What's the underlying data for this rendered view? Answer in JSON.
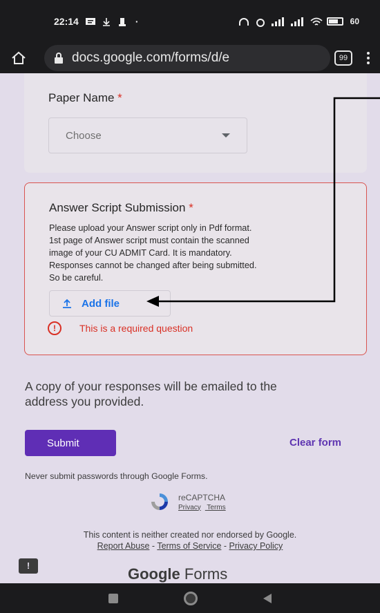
{
  "status_bar": {
    "time": "22:14",
    "battery": "60"
  },
  "browser": {
    "url": "docs.google.com/forms/d/e",
    "tab_count": "99"
  },
  "form": {
    "paper_question": {
      "title": "Paper Name",
      "required_mark": "*",
      "dropdown_value": "Choose"
    },
    "answer_question": {
      "title": "Answer Script Submission",
      "required_mark": "*",
      "description_lines": [
        "Please upload your Answer script only in Pdf format.",
        "1st page of Answer script must contain the scanned",
        "image of your CU ADMIT Card. It is mandatory.",
        "Responses cannot be changed after being submitted.",
        "So be careful."
      ],
      "add_file_label": "Add file",
      "error_text": "This is a required question"
    },
    "copy_note_line1": "A copy of your responses will be emailed to the",
    "copy_note_line2": "address you provided.",
    "submit_label": "Submit",
    "clear_label": "Clear form",
    "password_note": "Never submit passwords through Google Forms.",
    "recaptcha": {
      "title": "reCAPTCHA",
      "privacy": "Privacy",
      "terms": "Terms"
    },
    "disclaimer": "This content is neither created nor endorsed by Google.",
    "footer_links": {
      "report": "Report Abuse",
      "sep1": " - ",
      "tos": "Terms of Service",
      "sep2": " - ",
      "privacy": "Privacy Policy"
    },
    "logo": {
      "brand": "Google",
      "product": " Forms"
    }
  },
  "colors": {
    "accent": "#5f2eb5",
    "error": "#d93025",
    "link": "#1a73e8"
  }
}
